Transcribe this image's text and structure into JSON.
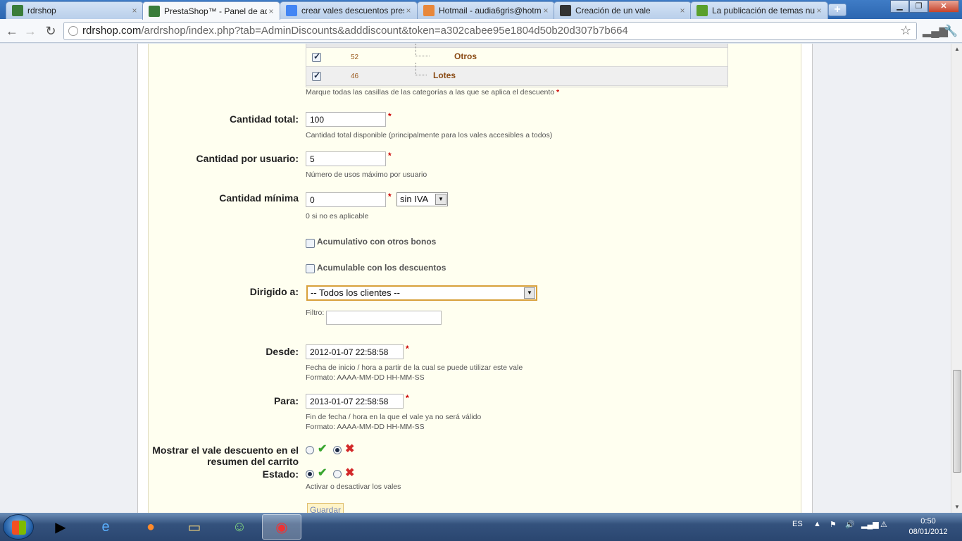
{
  "browser": {
    "tabs": [
      {
        "title": "rdrshop",
        "icon": "truck-icon",
        "color": "#3a7d3a",
        "active": false
      },
      {
        "title": "PrestaShop™ - Panel de adr",
        "icon": "truck-icon",
        "color": "#3a7d3a",
        "active": true
      },
      {
        "title": "crear vales descuentos prest",
        "icon": "google-icon",
        "color": "#4285f4",
        "active": false
      },
      {
        "title": "Hotmail - audia6gris@hotm",
        "icon": "hotmail-icon",
        "color": "#e8873a",
        "active": false
      },
      {
        "title": "Creación de un vale",
        "icon": "slideshare-icon",
        "color": "#333333",
        "active": false
      },
      {
        "title": "La publicación de temas nu",
        "icon": "forum-icon",
        "color": "#5aa02c",
        "active": false
      }
    ],
    "url_host": "rdrshop.com",
    "url_rest": "/ardrshop/index.php?tab=AdminDiscounts&adddiscount&token=a302cabee95e1804d50b20d307b7b664"
  },
  "categories": {
    "rows": [
      {
        "id": "52",
        "name": "Otros",
        "checked": true
      },
      {
        "id": "46",
        "name": "Lotes",
        "checked": true
      }
    ],
    "hint": "Marque todas las casillas de las categorías a las que se aplica el descuento",
    "required_mark": "*"
  },
  "form": {
    "total_qty": {
      "label": "Cantidad total:",
      "value": "100",
      "hint": "Cantidad total disponible (principalmente para los vales accesibles a todos)"
    },
    "per_user": {
      "label": "Cantidad por usuario:",
      "value": "5",
      "hint": "Número de usos máximo por usuario"
    },
    "min_qty": {
      "label": "Cantidad mínima",
      "value": "0",
      "tax_option": "sin IVA",
      "hint": "0 si no es aplicable"
    },
    "cumulative_vouchers": {
      "label": "Acumulativo con otros bonos",
      "checked": false
    },
    "cumulative_discounts": {
      "label": "Acumulable con los descuentos",
      "checked": false
    },
    "target": {
      "label": "Dirigido a:",
      "value": "-- Todos los clientes --",
      "filter_label": "Filtro:",
      "filter_value": ""
    },
    "from": {
      "label": "Desde:",
      "value": "2012-01-07 22:58:58",
      "hint1": "Fecha de inicio / hora a partir de la cual se puede utilizar este vale",
      "hint2": "Formato: AAAA-MM-DD HH-MM-SS"
    },
    "to": {
      "label": "Para:",
      "value": "2013-01-07 22:58:58",
      "hint1": "Fin de fecha / hora en la que el vale ya no será válido",
      "hint2": "Formato: AAAA-MM-DD HH-MM-SS"
    },
    "show_cart": {
      "label_line1": "Mostrar el vale descuento en el",
      "label_line2": "resumen del carrito",
      "selected": "no"
    },
    "status": {
      "label": "Estado:",
      "selected": "yes",
      "hint": "Activar o desactivar los vales"
    },
    "save_label": "Guardar"
  },
  "taskbar": {
    "apps": [
      "media-player-icon",
      "internet-explorer-icon",
      "firefox-icon",
      "explorer-icon",
      "messenger-icon",
      "chrome-icon"
    ],
    "lang": "ES",
    "time": "0:50",
    "date": "08/01/2012"
  }
}
